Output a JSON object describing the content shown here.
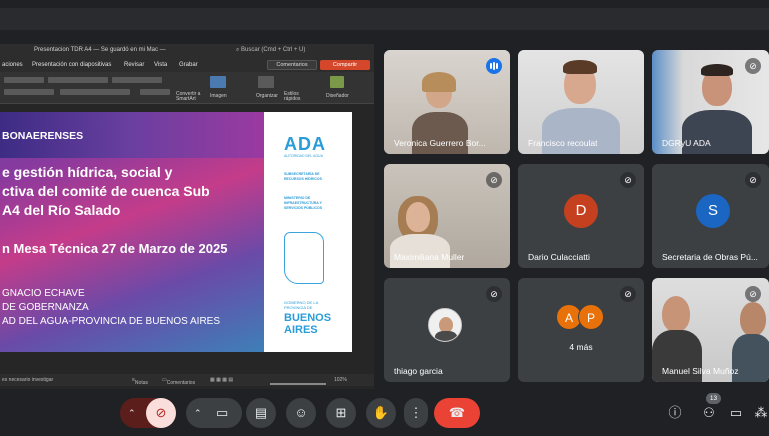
{
  "shared_window": {
    "title": "Presentacion TDR A4",
    "save_status": "— Se guardó en mi Mac —",
    "search_placeholder": "Buscar (Cmd + Ctrl + U)",
    "menu": [
      "aciones",
      "Presentación con diapositivas",
      "Revisar",
      "Vista",
      "Grabar"
    ],
    "comments_button": "Comentarios",
    "share_button": "Compartir",
    "ribbon_labels": [
      "Imagen",
      "Organizar",
      "Estilos rápidos",
      "Diseñador",
      "Convertir a SmartArt"
    ],
    "status_left": "es necesario investigar",
    "status_notes": "Notas",
    "status_comments": "Comentarios",
    "zoom": "102%"
  },
  "slide": {
    "header": "BONAERENSES",
    "title_line1": "e gestión hídrica, social y",
    "title_line2": "ctiva del comité de cuenca Sub",
    "title_line3": "A4 del Río Salado",
    "meeting_line": "n Mesa Técnica 27 de Marzo de 2025",
    "presenter_line1": "GNACIO ECHAVE",
    "presenter_line2": "DE GOBERNANZA",
    "presenter_line3": "AD DEL AGUA-PROVINCIA DE BUENOS AIRES",
    "logo": "ADA",
    "logo_sub": "AUTORIDAD DEL AGUA",
    "subsecretaria": "SUBSECRETARÍA DE RECURSOS HÍDRICOS",
    "ministerio": "MINISTERIO DE INFRAESTRUCTURA Y SERVICIOS PÚBLICOS",
    "gobierno": "GOBIERNO DE LA PROVINCIA DE",
    "buenos": "BUENOS",
    "aires": "AIRES"
  },
  "participants": [
    {
      "name": "Veronica Guerrero Bor...",
      "speaking": true
    },
    {
      "name": "Francisco recoulat"
    },
    {
      "name": "DGRyU ADA"
    },
    {
      "name": "Maximiliana Muller",
      "muted": true
    },
    {
      "name": "Dario Culacciatti",
      "initial": "D",
      "color": "#c5401f",
      "muted": true
    },
    {
      "name": "Secretaria de Obras Pú...",
      "initial": "S",
      "color": "#1a66c2",
      "muted": true
    },
    {
      "name": "thiago garcia",
      "muted": true
    },
    {
      "name": "4 más",
      "initials": [
        "A",
        "P"
      ],
      "color": "#e8710a",
      "muted": true
    },
    {
      "name": "Manuel Silva Muñoz",
      "muted": true
    }
  ],
  "controls": {
    "participant_count": "13"
  }
}
